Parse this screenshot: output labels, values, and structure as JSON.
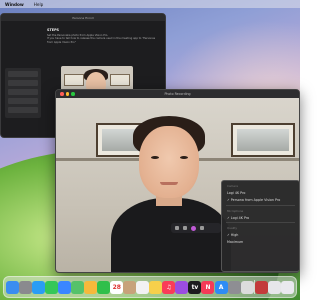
{
  "menubar": {
    "items": [
      "Window",
      "Help"
    ]
  },
  "back_window": {
    "title": "Persona Enroll",
    "heading": "STEPS",
    "lines": [
      "Set the Personalia photo from Apple Vision Pro.",
      "If you have to tell how to release the camera used in the meeting app to \"Personas from Apple Vision Pro\""
    ],
    "sidebar_rows": [
      "",
      "",
      "",
      "",
      ""
    ]
  },
  "front_window": {
    "title": "Photo Recording"
  },
  "popup_menu": {
    "section_camera": "Camera",
    "camera_options": [
      "Logi 4K Pro",
      "✓ Persona from Apple Vision Pro"
    ],
    "section_microphone": "Microphone",
    "microphone_options": [
      "✓ Logi 4K Pro"
    ],
    "section_quality": "Quality",
    "quality_options": [
      "✓ High",
      "Maximum"
    ]
  },
  "dock": {
    "items": [
      {
        "name": "finder-icon",
        "label": "",
        "color": "#3b8df0"
      },
      {
        "name": "launchpad-icon",
        "label": "",
        "color": "#8a8a8e"
      },
      {
        "name": "safari-icon",
        "label": "",
        "color": "#2a9df4"
      },
      {
        "name": "messages-icon",
        "label": "",
        "color": "#35c759"
      },
      {
        "name": "mail-icon",
        "label": "",
        "color": "#3a86ff"
      },
      {
        "name": "maps-icon",
        "label": "",
        "color": "#55c26a"
      },
      {
        "name": "photos-icon",
        "label": "",
        "color": "#f6b93b"
      },
      {
        "name": "facetime-icon",
        "label": "",
        "color": "#2fbf4b"
      },
      {
        "name": "calendar-icon",
        "label": "28",
        "color": "#ffffff"
      },
      {
        "name": "contacts-icon",
        "label": "",
        "color": "#c7a27a"
      },
      {
        "name": "reminders-icon",
        "label": "",
        "color": "#f2f2f2"
      },
      {
        "name": "notes-icon",
        "label": "",
        "color": "#f7d04b"
      },
      {
        "name": "music-icon",
        "label": "♫",
        "color": "#fa3c58"
      },
      {
        "name": "podcasts-icon",
        "label": "",
        "color": "#9b4de0"
      },
      {
        "name": "appletv-icon",
        "label": "tv",
        "color": "#1c1c1e"
      },
      {
        "name": "news-icon",
        "label": "N",
        "color": "#f53b57"
      },
      {
        "name": "appstore-icon",
        "label": "A",
        "color": "#2e8cf4"
      },
      {
        "name": "settings-icon",
        "label": "",
        "color": "#8e8e93"
      },
      {
        "name": "preview-icon",
        "label": "",
        "color": "#dcdcdc"
      },
      {
        "name": "photobooth-icon",
        "label": "",
        "color": "#c33b3b"
      },
      {
        "name": "downloads-icon",
        "label": "",
        "color": "#e6e6ea"
      },
      {
        "name": "trash-icon",
        "label": "",
        "color": "#e9e9ee"
      }
    ]
  }
}
